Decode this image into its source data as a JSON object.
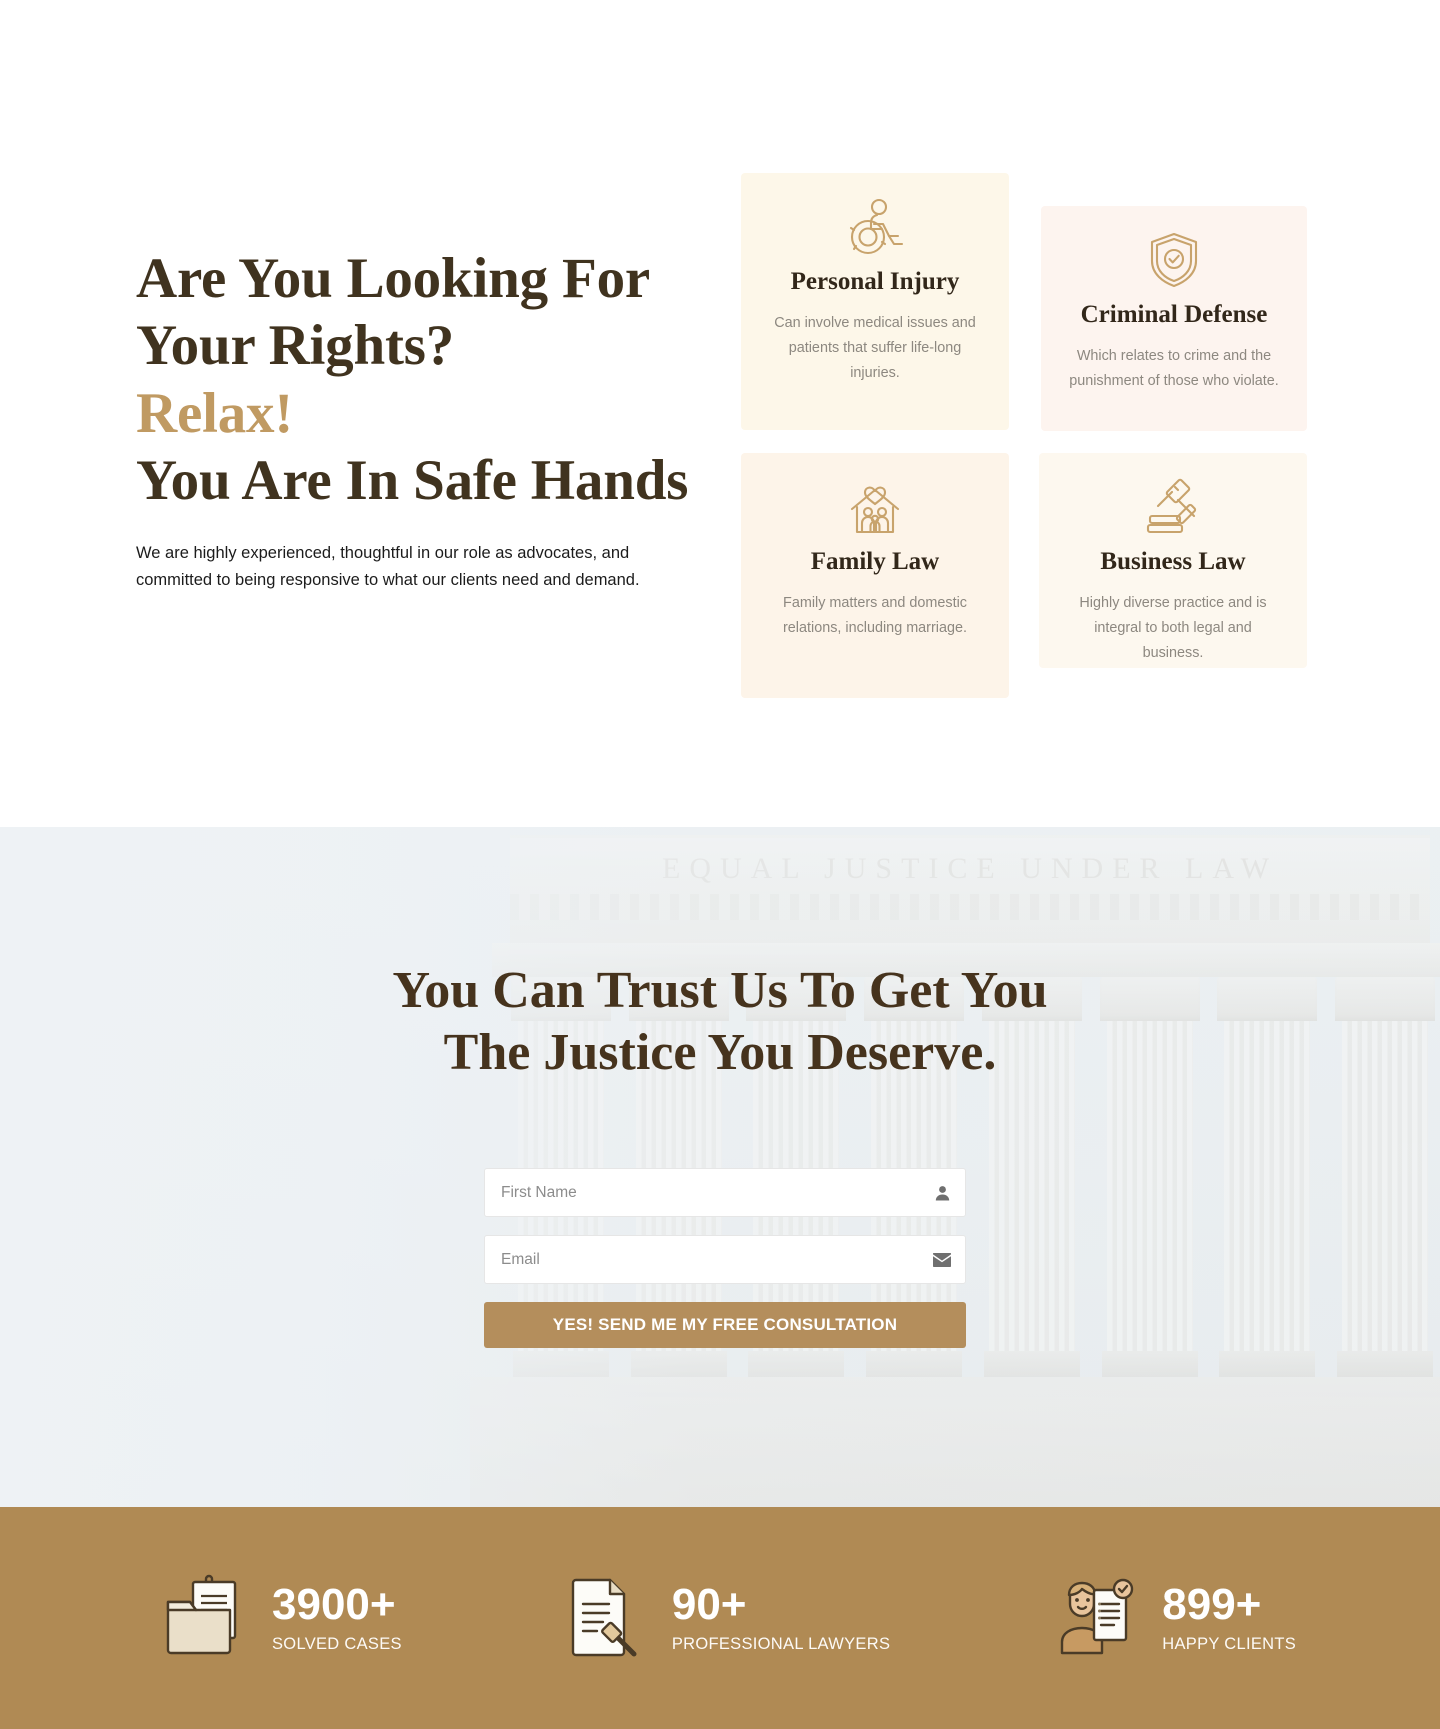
{
  "hero": {
    "headline_line1": "Are You Looking For",
    "headline_line2": "Your Rights?",
    "headline_accent": "Relax!",
    "headline_line3": "You Are In Safe Hands",
    "paragraph": "We are highly experienced, thoughtful in our role as advocates, and committed to being responsive to what our clients need and demand."
  },
  "services": [
    {
      "icon": "wheelchair-icon",
      "title": "Personal Injury",
      "desc": "Can involve medical issues and patients that suffer life-long injuries.",
      "bg": "#fdf7e9"
    },
    {
      "icon": "shield-check-icon",
      "title": "Criminal Defense",
      "desc": "Which relates to crime and the punishment of those who violate.",
      "bg": "#fdf4ef"
    },
    {
      "icon": "house-heart-icon",
      "title": "Family Law",
      "desc": "Family matters and domestic relations, including marriage.",
      "bg": "#fdf4e9"
    },
    {
      "icon": "gavel-icon",
      "title": "Business Law",
      "desc": "Highly diverse practice and is integral to both legal and business.",
      "bg": "#fdf8ef"
    }
  ],
  "trust": {
    "heading_line1": "You Can Trust Us To Get You",
    "heading_line2": "The Justice You Deserve.",
    "building_inscription": "EQUAL JUSTICE UNDER LAW"
  },
  "form": {
    "first_name_placeholder": "First Name",
    "first_name_value": "",
    "first_name_icon": "person-icon",
    "email_placeholder": "Email",
    "email_value": "",
    "email_icon": "envelope-icon",
    "submit_label": "YES! SEND ME MY FREE CONSULTATION"
  },
  "stats": [
    {
      "icon": "folder-document-icon",
      "number": "3900+",
      "label": "SOLVED CASES"
    },
    {
      "icon": "document-gavel-icon",
      "number": "90+",
      "label": "PROFESSIONAL LAWYERS"
    },
    {
      "icon": "client-checklist-icon",
      "number": "899+",
      "label": "HAPPY CLIENTS"
    }
  ],
  "colors": {
    "brand_brown": "#40331f",
    "accent_gold": "#c09a62",
    "stats_bar": "#b08a54",
    "cta": "#b48e5c"
  }
}
